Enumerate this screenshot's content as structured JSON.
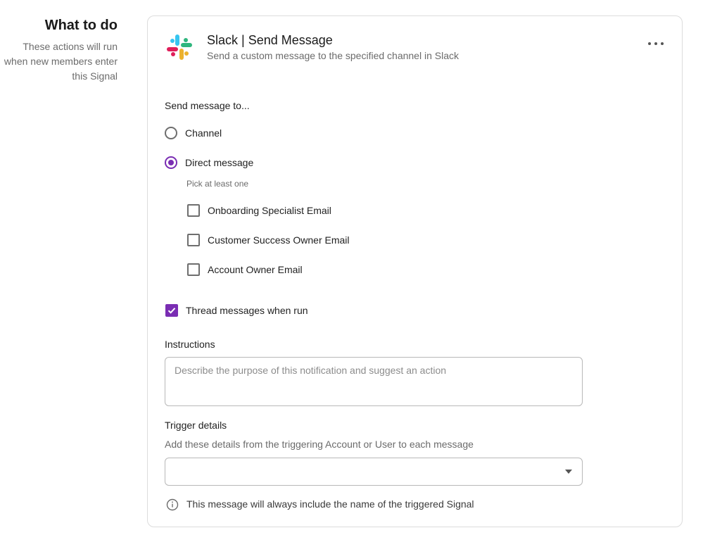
{
  "side": {
    "heading": "What to do",
    "description": "These actions will run when new members enter this Signal"
  },
  "card": {
    "title": "Slack | Send Message",
    "subtitle": "Send a custom message to the specified channel in Slack",
    "send_to_label": "Send message to...",
    "radio_options": [
      {
        "label": "Channel",
        "selected": false
      },
      {
        "label": "Direct message",
        "selected": true
      }
    ],
    "pick_hint": "Pick at least one",
    "recipients": [
      {
        "label": "Onboarding Specialist Email",
        "checked": false
      },
      {
        "label": "Customer Success Owner Email",
        "checked": false
      },
      {
        "label": "Account Owner Email",
        "checked": false
      }
    ],
    "thread": {
      "label": "Thread messages when run",
      "checked": true
    },
    "instructions": {
      "label": "Instructions",
      "placeholder": "Describe the purpose of this notification and suggest an action"
    },
    "trigger": {
      "label": "Trigger details",
      "description": "Add these details from the triggering Account or User to each message",
      "selected_value": ""
    },
    "info_note": "This message will always include the name of the triggered Signal"
  },
  "colors": {
    "accent": "#7a2db3"
  },
  "icons": [
    "slack-logo-icon",
    "more-horizontal-icon",
    "info-icon",
    "chevron-down-icon"
  ]
}
